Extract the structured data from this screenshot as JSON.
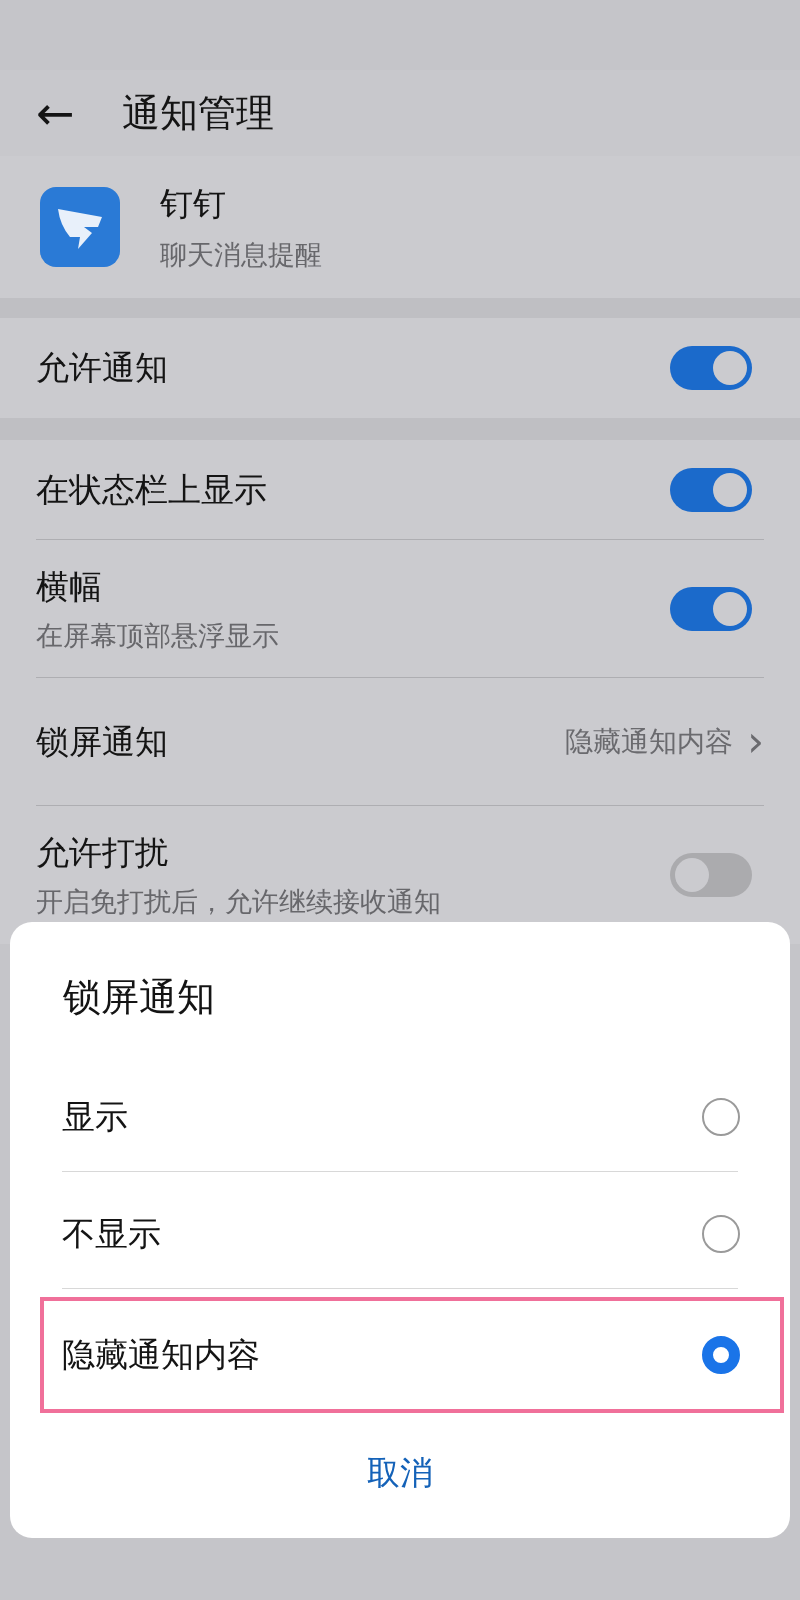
{
  "header": {
    "back": "←",
    "title": "通知管理"
  },
  "app": {
    "name": "钉钉",
    "subtitle": "聊天消息提醒"
  },
  "allow": {
    "label": "允许通知",
    "on": true
  },
  "settings": [
    {
      "kind": "toggle",
      "label": "在状态栏上显示",
      "on": true
    },
    {
      "kind": "toggle",
      "label": "横幅",
      "subtitle": "在屏幕顶部悬浮显示",
      "on": true
    },
    {
      "kind": "link",
      "label": "锁屏通知",
      "value": "隐藏通知内容",
      "chevron": "›"
    },
    {
      "kind": "toggle",
      "label": "允许打扰",
      "subtitle": "开启免打扰后，允许继续接收通知",
      "on": false
    }
  ],
  "dialog": {
    "title": "锁屏通知",
    "options": [
      {
        "label": "显示",
        "selected": false,
        "highlighted": false
      },
      {
        "label": "不显示",
        "selected": false,
        "highlighted": false
      },
      {
        "label": "隐藏通知内容",
        "selected": true,
        "highlighted": true
      }
    ],
    "cancel": "取消"
  }
}
